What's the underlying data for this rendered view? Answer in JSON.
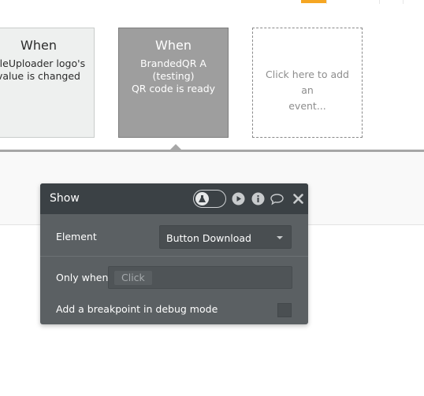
{
  "events": [
    {
      "title": "When",
      "line1": "FileUploader logo's",
      "line2": "value is changed"
    },
    {
      "title": "When",
      "line1": "BrandedQR A (testing)",
      "line2": "QR code is ready"
    }
  ],
  "add_event": {
    "line1": "Click here to add an",
    "line2": "event..."
  },
  "action_panel": {
    "title": "Show",
    "element_label": "Element",
    "element_value": "Button Download",
    "only_when_label": "Only when",
    "condition_placeholder": "Click",
    "breakpoint_label": "Add a breakpoint in debug mode",
    "breakpoint_checked": false
  },
  "colors": {
    "accent": "#f5a623",
    "panel_body": "#5b6063",
    "panel_header": "#3b4145",
    "selected_event": "#9e9e9e"
  },
  "icons": [
    "flask-icon",
    "play-icon",
    "info-icon",
    "comment-icon",
    "close-icon"
  ]
}
